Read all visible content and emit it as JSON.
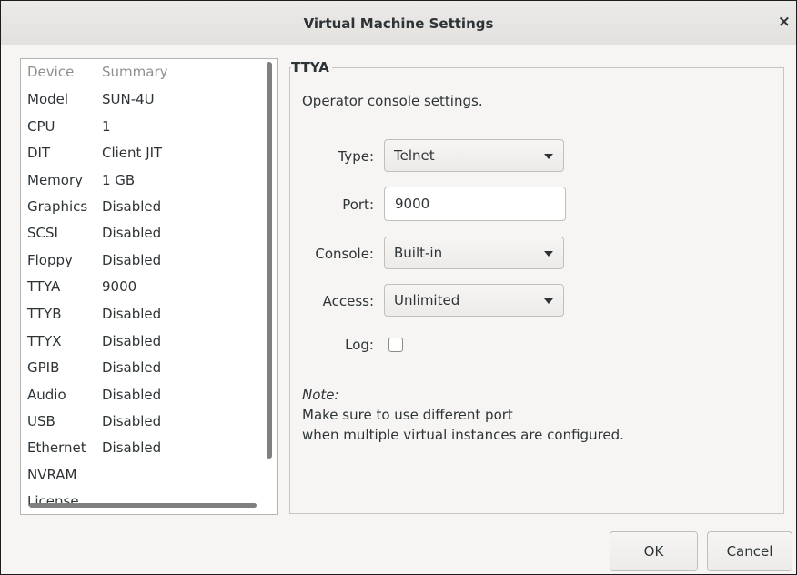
{
  "window": {
    "title": "Virtual Machine Settings",
    "close": "×"
  },
  "devices": {
    "headers": {
      "device": "Device",
      "summary": "Summary"
    },
    "rows": [
      {
        "device": "Model",
        "summary": "SUN-4U"
      },
      {
        "device": "CPU",
        "summary": "1"
      },
      {
        "device": "DIT",
        "summary": "Client JIT"
      },
      {
        "device": "Memory",
        "summary": "1 GB"
      },
      {
        "device": "Graphics",
        "summary": "Disabled"
      },
      {
        "device": "SCSI",
        "summary": "Disabled"
      },
      {
        "device": "Floppy",
        "summary": "Disabled"
      },
      {
        "device": "TTYA",
        "summary": "9000"
      },
      {
        "device": "TTYB",
        "summary": "Disabled"
      },
      {
        "device": "TTYX",
        "summary": "Disabled"
      },
      {
        "device": "GPIB",
        "summary": "Disabled"
      },
      {
        "device": "Audio",
        "summary": "Disabled"
      },
      {
        "device": "USB",
        "summary": "Disabled"
      },
      {
        "device": "Ethernet",
        "summary": "Disabled"
      },
      {
        "device": "NVRAM",
        "summary": ""
      },
      {
        "device": "License",
        "summary": ""
      }
    ]
  },
  "settings": {
    "group_title": "TTYA",
    "intro": "Operator console settings.",
    "type": {
      "label": "Type:",
      "value": "Telnet"
    },
    "port": {
      "label": "Port:",
      "value": "9000"
    },
    "console": {
      "label": "Console:",
      "value": "Built-in"
    },
    "access": {
      "label": "Access:",
      "value": "Unlimited"
    },
    "log": {
      "label": "Log:",
      "checked": false
    },
    "note_label": "Note:",
    "note_line1": "Make sure to use different port",
    "note_line2": "when multiple virtual instances are configured."
  },
  "buttons": {
    "ok": "OK",
    "cancel": "Cancel"
  }
}
